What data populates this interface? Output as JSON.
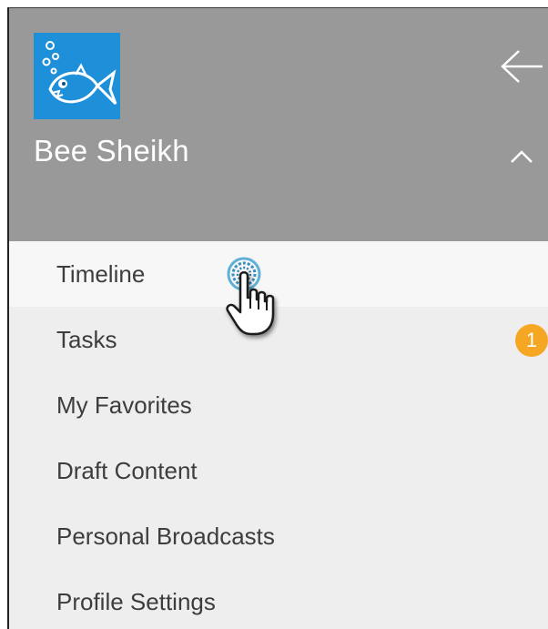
{
  "header": {
    "user_name": "Bee Sheikh",
    "avatar_icon": "fish-avatar-icon",
    "back_icon": "arrow-left-icon",
    "collapse_icon": "chevron-up-icon"
  },
  "menu": {
    "items": [
      {
        "label": "Timeline"
      },
      {
        "label": "Tasks",
        "badge": "1"
      },
      {
        "label": "My Favorites"
      },
      {
        "label": "Draft Content"
      },
      {
        "label": "Personal Broadcasts"
      },
      {
        "label": "Profile Settings"
      }
    ]
  },
  "colors": {
    "header_bg": "#999999",
    "menu_bg": "#eeeeee",
    "active_item_bg": "#f7f7f7",
    "badge_bg": "#f5a623",
    "avatar_bg": "#1e8fd9"
  },
  "cursor_icon": "hand-pointer-icon"
}
